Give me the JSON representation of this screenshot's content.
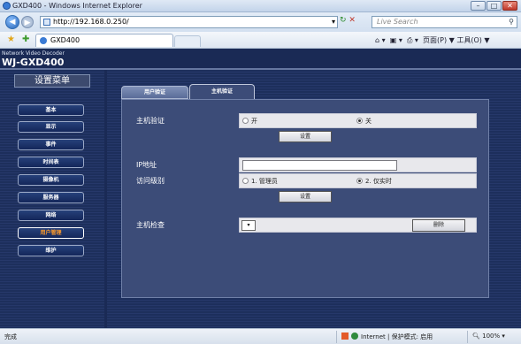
{
  "browser": {
    "title": "GXD400 - Windows Internet Explorer",
    "url": "http://192.168.0.250/",
    "search_placeholder": "Live Search",
    "tab_label": "GXD400",
    "toolbar_text": "页面(P) ▼  工具(O) ▼",
    "status_done": "完成",
    "status_zone": "Internet | 保护模式: 启用",
    "zoom": "100%"
  },
  "header": {
    "subtitle": "Network Video Decoder",
    "model": "WJ-GXD400"
  },
  "sidebar": {
    "title": "设置菜单",
    "items": [
      {
        "label": "基本"
      },
      {
        "label": "显示"
      },
      {
        "label": "事件"
      },
      {
        "label": "时间表"
      },
      {
        "label": "摄像机"
      },
      {
        "label": "服务器"
      },
      {
        "label": "网络"
      },
      {
        "label": "用户管理",
        "active": true
      },
      {
        "label": "维护"
      }
    ]
  },
  "tabs": {
    "user_auth": "用户验证",
    "host_auth": "主机验证"
  },
  "form": {
    "host_auth_label": "主机验证",
    "opt_on": "开",
    "opt_off": "关",
    "host_auth_value": "off",
    "set_button_1": "设置",
    "ip_label": "IP地址",
    "ip_value": "",
    "access_label": "访问级别",
    "level_1": "1. 管理员",
    "level_2": "2. 仅实时",
    "access_value": "2",
    "set_button_2": "设置",
    "host_check_label": "主机检查",
    "host_check_value": "",
    "delete_button": "删除"
  }
}
